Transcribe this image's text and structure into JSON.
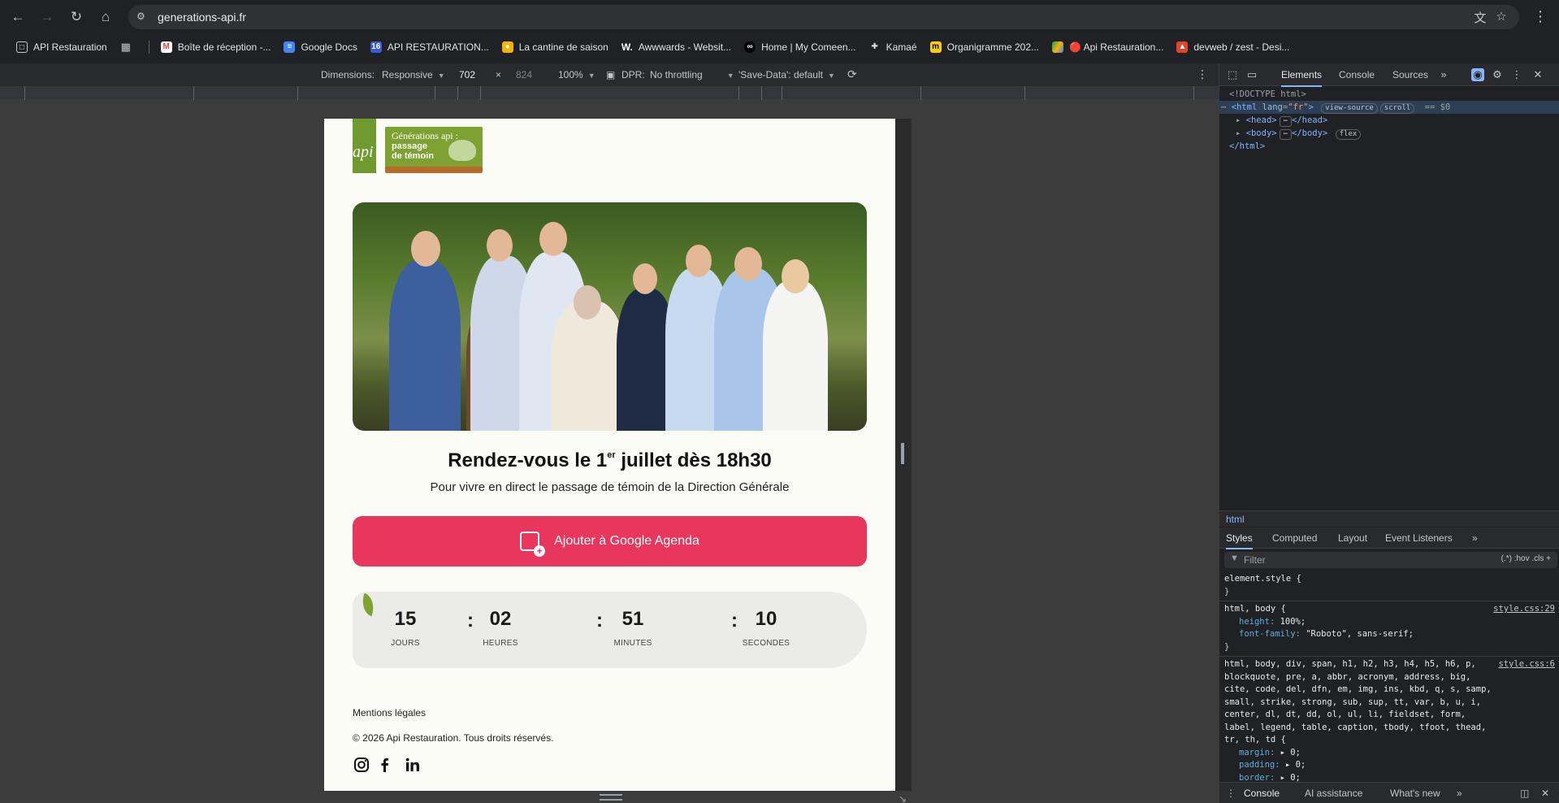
{
  "browser": {
    "url": "generations-api.fr",
    "bookmarks": [
      "API Restauration",
      "Boîte de réception -...",
      "Google Docs",
      "API RESTAURATION...",
      "La cantine de saison",
      "Awwwards - Websit...",
      "Home | My Comeen...",
      "Kamaé",
      "Organigramme 202...",
      "🔴 Api Restauration...",
      "devweb / zest - Desi..."
    ]
  },
  "device_toolbar": {
    "dimensions_label": "Dimensions:",
    "preset": "Responsive",
    "width": "702",
    "times": "×",
    "height": "824",
    "zoom": "100%",
    "dpr_label": "DPR:",
    "throttling": "No throttling",
    "save_data": "'Save-Data': default"
  },
  "page": {
    "logo_api": "api",
    "logo_gen_line1": "Générations api :",
    "logo_gen_line2": "passage",
    "logo_gen_line3": "de témoin",
    "headline_pre": "Rendez-vous le 1",
    "headline_sup": "er",
    "headline_post": " juillet dès 18h30",
    "subline": "Pour vivre en direct le passage de témoin de la Direction Générale",
    "cta_label": "Ajouter à Google Agenda",
    "countdown": {
      "days": "15",
      "days_label": "JOURS",
      "hours": "02",
      "hours_label": "HEURES",
      "minutes": "51",
      "minutes_label": "MINUTES",
      "seconds": "10",
      "seconds_label": "SECONDES",
      "separator": ":"
    },
    "footer_link": "Mentions légales",
    "footer_copy": "© 2026 Api Restauration. Tous droits réservés."
  },
  "devtools": {
    "tabs": [
      "Elements",
      "Console",
      "Sources"
    ],
    "dom": {
      "doctype": "<!DOCTYPE html>",
      "html_open": "<html",
      "lang_attr": "lang",
      "lang_val": "\"fr\"",
      "view_source": "view-source",
      "scroll": "scroll",
      "dollar": "== $0",
      "head": "<head>",
      "head_close": "</head>",
      "body": "<body>",
      "body_close": "</body>",
      "flex": "flex",
      "html_close": "</html>",
      "ellipsis": "⋯",
      "gt": ">"
    },
    "breadcrumb": "html",
    "style_tabs": [
      "Styles",
      "Computed",
      "Layout",
      "Event Listeners"
    ],
    "filter_placeholder": "Filter",
    "filter_opts": "(.*)  :hov  .cls  +",
    "rules": {
      "element_style": "element.style {",
      "close": "}",
      "r1_selector": "html, body {",
      "r1_src": "style.css:29",
      "r1_p1": "height",
      "r1_v1": "100%;",
      "r1_p2": "font-family",
      "r1_v2": "\"Roboto\", sans-serif;",
      "r2_selector": "html, body, div, span, h1, h2, h3, h4, h5, h6, p, blockquote, pre, a, abbr, acronym, address, big, cite, code, del, dfn, em, img, ins, kbd, q, s, samp, small, strike, strong, sub, sup, tt, var, b, u, i, center, dl, dt, dd, ol, ul, li, fieldset, form, label, legend, table, caption, tbody, tfoot, thead, tr, th, td {",
      "r2_src": "style.css:6",
      "r2_p1": "margin",
      "r2_v1": "▸ 0;",
      "r2_p2": "padding",
      "r2_v2": "▸ 0;",
      "r2_p3": "border",
      "r2_v3": "▸ 0;"
    },
    "bottom_tabs": [
      "Console",
      "AI assistance",
      "What's new"
    ]
  },
  "colors": {
    "accent": "#e8365d",
    "brand_green": "#7ea232",
    "devtools_blue": "#8ab4f8"
  }
}
